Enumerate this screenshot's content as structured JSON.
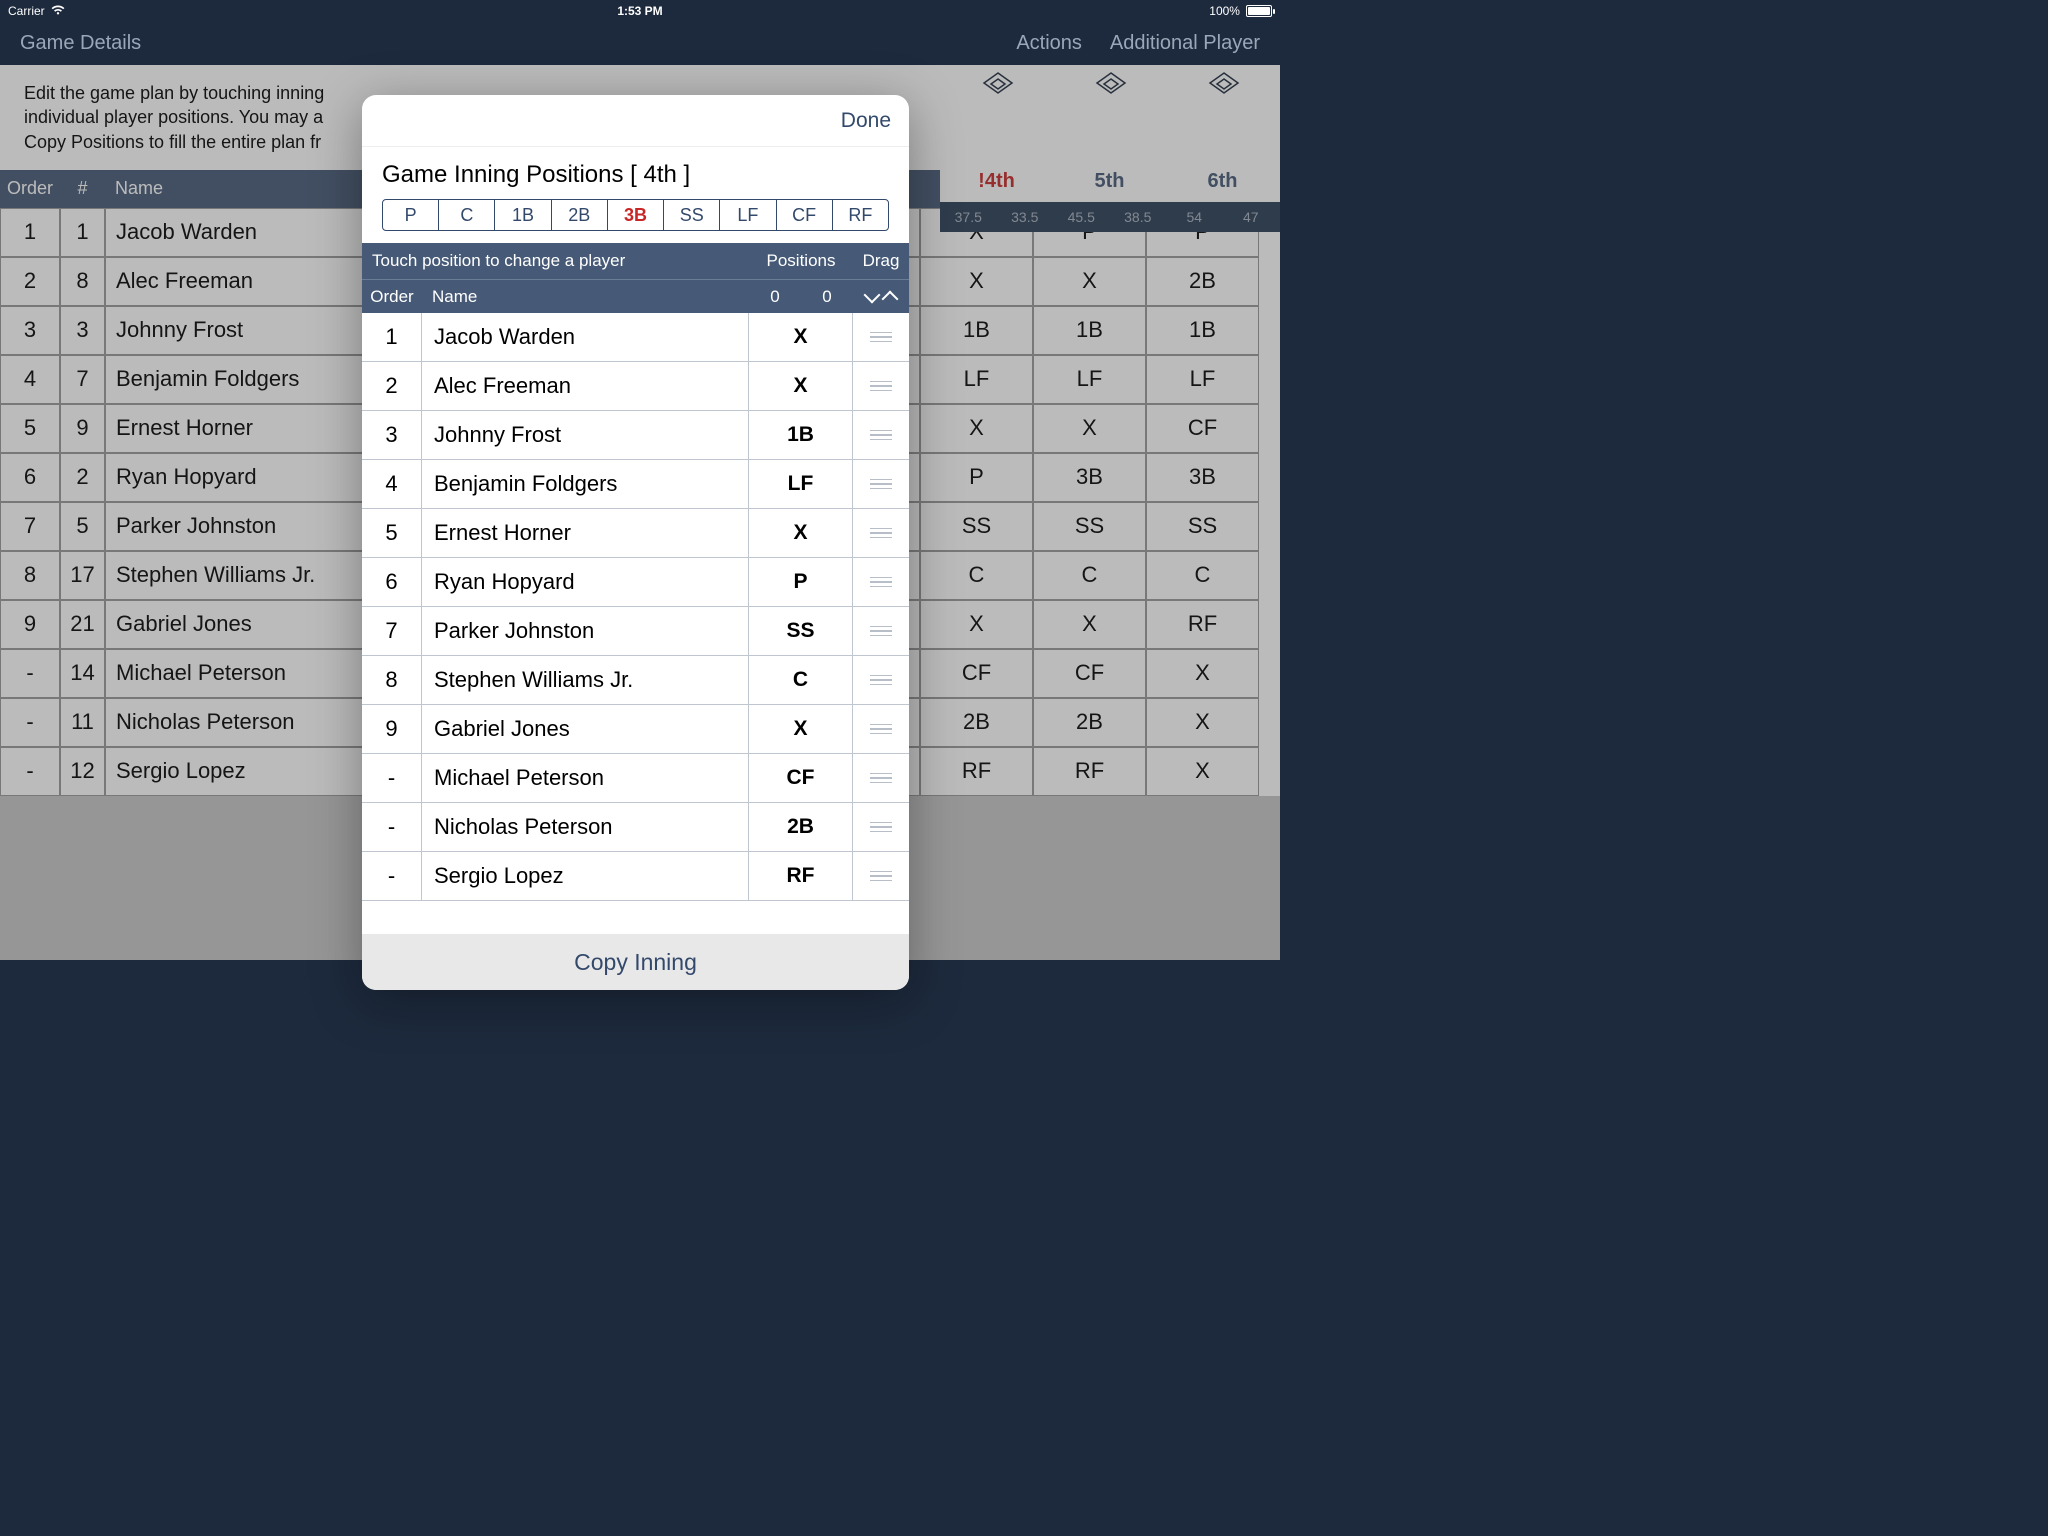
{
  "statusbar": {
    "carrier": "Carrier",
    "time": "1:53 PM",
    "battery": "100%"
  },
  "nav": {
    "left": "Game Details",
    "actions": "Actions",
    "additional": "Additional Player",
    "done": "Done"
  },
  "desc_lines": [
    "Edit the game plan by touching inning",
    "individual player positions. You may a",
    "Copy Positions to fill the entire plan fr"
  ],
  "bg_headers": {
    "order": "Order",
    "num": "#",
    "name": "Name"
  },
  "innings": [
    {
      "label": "!4th",
      "active": true,
      "stats": [
        "37.5",
        "33.5"
      ]
    },
    {
      "label": "5th",
      "active": false,
      "stats": [
        "45.5",
        "38.5"
      ]
    },
    {
      "label": "6th",
      "active": false,
      "stats": [
        "54",
        "47"
      ]
    }
  ],
  "bg_rows": [
    {
      "order": "1",
      "num": "1",
      "name": "Jacob Warden",
      "pos": [
        "X",
        "P",
        "P"
      ]
    },
    {
      "order": "2",
      "num": "8",
      "name": "Alec Freeman",
      "pos": [
        "X",
        "X",
        "2B"
      ]
    },
    {
      "order": "3",
      "num": "3",
      "name": "Johnny Frost",
      "pos": [
        "1B",
        "1B",
        "1B"
      ]
    },
    {
      "order": "4",
      "num": "7",
      "name": "Benjamin Foldgers",
      "pos": [
        "LF",
        "LF",
        "LF"
      ]
    },
    {
      "order": "5",
      "num": "9",
      "name": "Ernest Horner",
      "pos": [
        "X",
        "X",
        "CF"
      ]
    },
    {
      "order": "6",
      "num": "2",
      "name": "Ryan Hopyard",
      "pos": [
        "P",
        "3B",
        "3B"
      ]
    },
    {
      "order": "7",
      "num": "5",
      "name": "Parker Johnston",
      "pos": [
        "SS",
        "SS",
        "SS"
      ]
    },
    {
      "order": "8",
      "num": "17",
      "name": "Stephen  Williams Jr.",
      "pos": [
        "C",
        "C",
        "C"
      ]
    },
    {
      "order": "9",
      "num": "21",
      "name": "Gabriel Jones",
      "pos": [
        "X",
        "X",
        "RF"
      ]
    },
    {
      "order": "-",
      "num": "14",
      "name": "Michael Peterson",
      "pos": [
        "CF",
        "CF",
        "X"
      ]
    },
    {
      "order": "-",
      "num": "11",
      "name": "Nicholas Peterson",
      "pos": [
        "2B",
        "2B",
        "X"
      ]
    },
    {
      "order": "-",
      "num": "12",
      "name": "Sergio Lopez",
      "pos": [
        "RF",
        "RF",
        "X"
      ]
    }
  ],
  "modal": {
    "title": "Game Inning Positions [ 4th ]",
    "positions_segments": [
      "P",
      "C",
      "1B",
      "2B",
      "3B",
      "SS",
      "LF",
      "CF",
      "RF"
    ],
    "selected_segment": "3B",
    "hint": "Touch position to change a player",
    "positions_label": "Positions",
    "drag_label": "Drag",
    "col_order": "Order",
    "col_name": "Name",
    "col_p1": "0",
    "col_p2": "0",
    "rows": [
      {
        "order": "1",
        "name": "Jacob Warden",
        "pos": "X"
      },
      {
        "order": "2",
        "name": "Alec Freeman",
        "pos": "X"
      },
      {
        "order": "3",
        "name": "Johnny Frost",
        "pos": "1B"
      },
      {
        "order": "4",
        "name": "Benjamin Foldgers",
        "pos": "LF"
      },
      {
        "order": "5",
        "name": "Ernest Horner",
        "pos": "X"
      },
      {
        "order": "6",
        "name": "Ryan Hopyard",
        "pos": "P"
      },
      {
        "order": "7",
        "name": "Parker Johnston",
        "pos": "SS"
      },
      {
        "order": "8",
        "name": "Stephen  Williams Jr.",
        "pos": "C"
      },
      {
        "order": "9",
        "name": "Gabriel Jones",
        "pos": "X"
      },
      {
        "order": "-",
        "name": "Michael Peterson",
        "pos": "CF"
      },
      {
        "order": "-",
        "name": "Nicholas Peterson",
        "pos": "2B"
      },
      {
        "order": "-",
        "name": "Sergio Lopez",
        "pos": "RF"
      }
    ],
    "footer": "Copy Inning"
  }
}
